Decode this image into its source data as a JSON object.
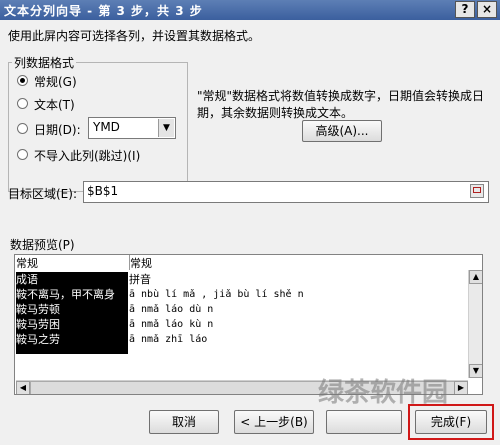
{
  "window": {
    "title": "文本分列向导 - 第 3 步，共 3 步",
    "help_button": "?",
    "close_button": "×"
  },
  "instruction": "使用此屏内容可选择各列，并设置其数据格式。",
  "column_format": {
    "group_label": "列数据格式",
    "options": [
      {
        "label": "常规(G)",
        "checked": true
      },
      {
        "label": "文本(T)",
        "checked": false
      },
      {
        "label": "日期(D):",
        "checked": false
      },
      {
        "label": "不导入此列(跳过)(I)",
        "checked": false
      }
    ],
    "date_select_value": "YMD"
  },
  "description": {
    "line1": "\"常规\"数据格式将数值转换成数字，日期值会转换成日",
    "line2": "期，其余数据则转换成文本。"
  },
  "advanced_button": "高级(A)...",
  "target": {
    "label": "目标区域(E):",
    "value": "$B$1"
  },
  "preview": {
    "group_label": "数据预览(P)",
    "headers": [
      "常规",
      "常规"
    ],
    "rows": [
      [
        "成语",
        "拼音"
      ],
      [
        "鞍不离马，甲不离身",
        "ā nbù lí mǎ , jiǎ bù lí shě n"
      ],
      [
        "鞍马劳顿",
        "ā nmǎ láo dù n"
      ],
      [
        "鞍马劳困",
        "ā nmǎ láo kù n"
      ],
      [
        "鞍马之劳",
        "ā nmǎ zhī láo"
      ]
    ]
  },
  "buttons": {
    "cancel": "取消",
    "back": "< 上一步(B)",
    "finish": "完成(F)"
  },
  "watermark": "绿茶软件园"
}
